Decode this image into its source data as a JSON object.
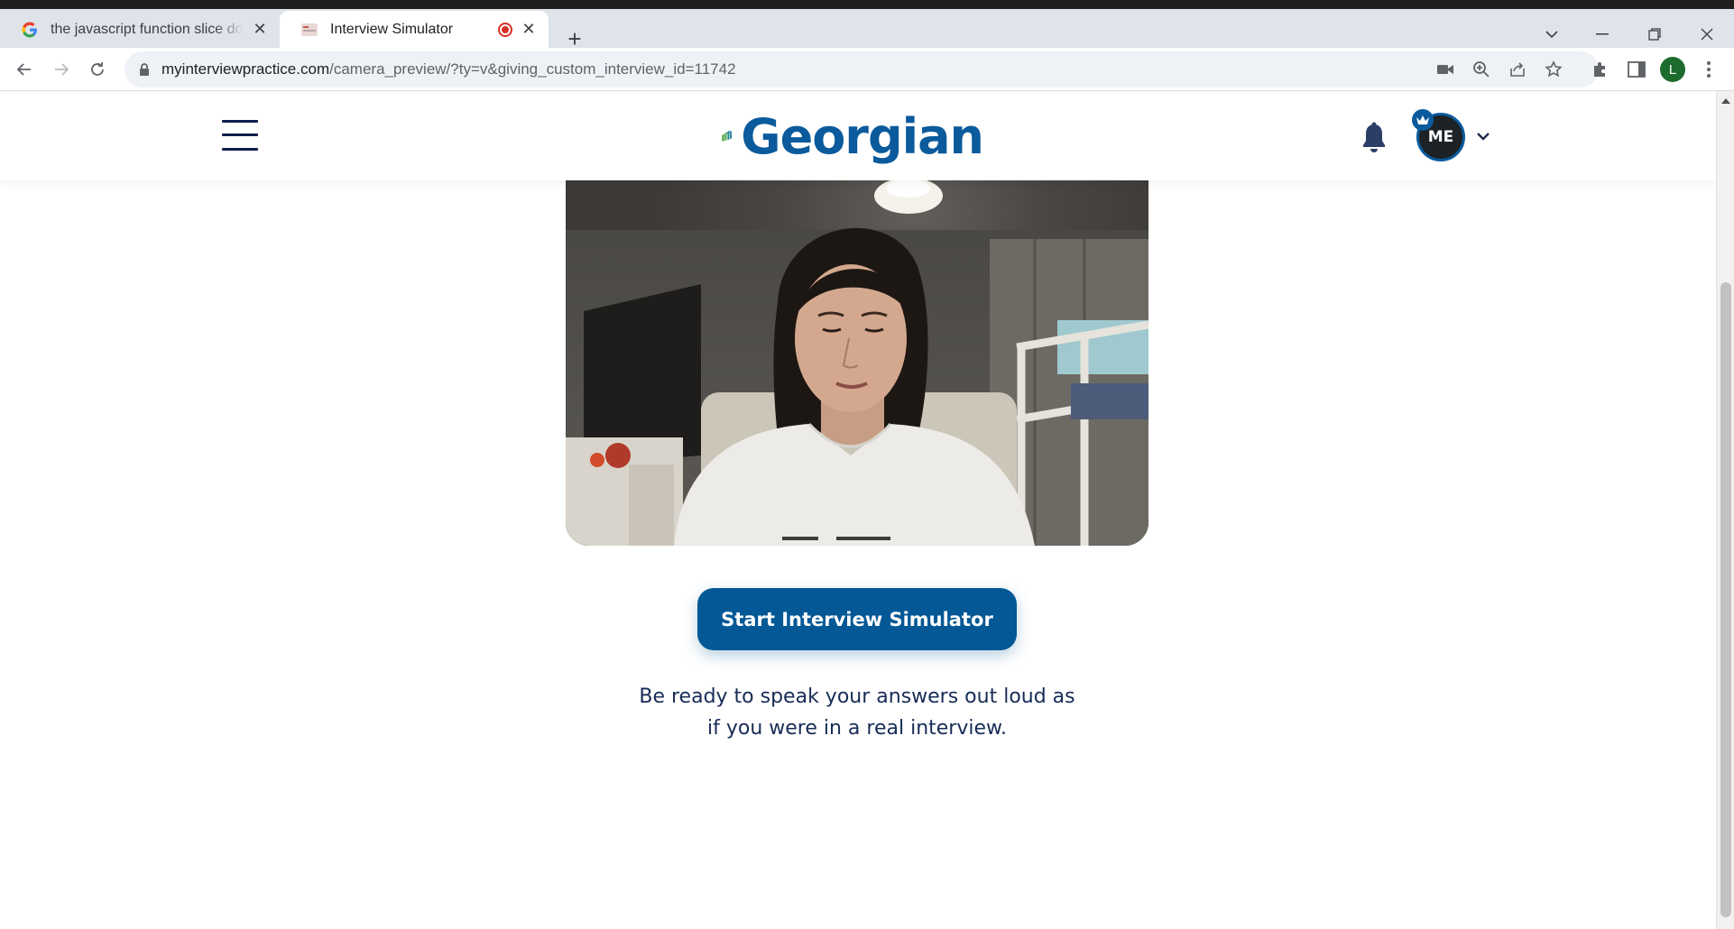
{
  "browser": {
    "tabs": [
      {
        "title": "the javascript function slice does",
        "favicon": "google-g-icon",
        "active": false
      },
      {
        "title": "Interview Simulator",
        "favicon": "site-favicon",
        "active": true,
        "recording": true
      }
    ],
    "new_tab_label": "+",
    "url_host": "myinterviewpractice.com",
    "url_path": "/camera_preview/?ty=v&giving_custom_interview_id=11742",
    "profile_initial": "L"
  },
  "site": {
    "logo_text": "Georgian",
    "avatar_initials": "ME",
    "start_button_label": "Start Interview Simulator",
    "helper_text": "Be ready to speak your answers out loud as if you were in a real interview."
  },
  "colors": {
    "brand_blue": "#035895",
    "navy_text": "#172c56",
    "logo_green": "#4aa13b"
  }
}
